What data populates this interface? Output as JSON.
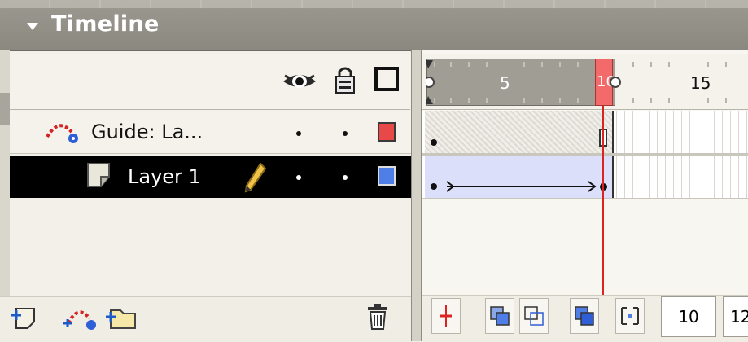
{
  "panel": {
    "title": "Timeline"
  },
  "header": {
    "eye_icon": "eye-icon",
    "lock_icon": "lock-icon",
    "outline_icon": "outline-icon"
  },
  "layers": [
    {
      "name": "Guide: La...",
      "type": "guide",
      "visible_dot": "•",
      "locked_dot": "•",
      "color": "#e84848"
    },
    {
      "name": "Layer 1",
      "type": "normal",
      "selected": true,
      "visible_dot": "•",
      "locked_dot": "•",
      "color": "#4f7fe6"
    }
  ],
  "ruler": {
    "ticks": [
      "5",
      "10",
      "15"
    ],
    "current_frame": "10"
  },
  "footer": {
    "current_frame_value": "10",
    "frame_rate_value": "12"
  }
}
